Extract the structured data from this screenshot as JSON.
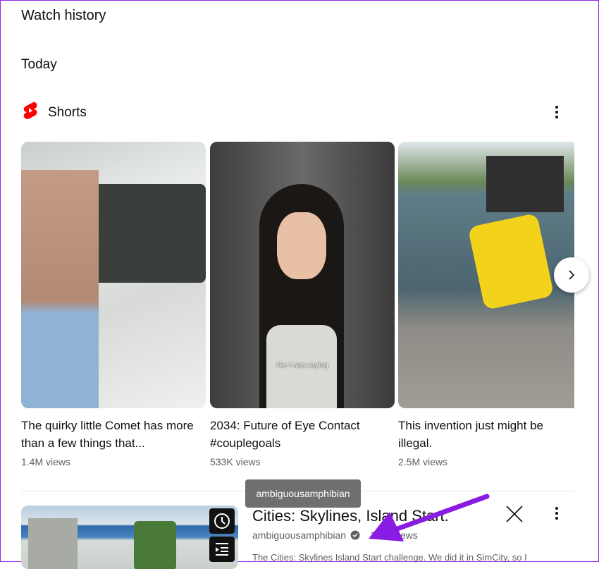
{
  "page_title": "Watch history",
  "section_date": "Today",
  "shorts": {
    "label": "Shorts",
    "icon": "youtube-shorts-icon",
    "brand_color": "#ff0000",
    "items": [
      {
        "title": "The quirky little Comet has more than a few things that...",
        "views": "1.4M views"
      },
      {
        "title": "2034: Future of Eye Contact #couplegoals",
        "views": "533K views",
        "caption": "like I was saying"
      },
      {
        "title": "This invention just might be illegal.",
        "views": "2.5M views"
      }
    ]
  },
  "video": {
    "title": "Cities: Skylines, Island Start.",
    "channel": "ambiguousamphibian",
    "views": "1.6K views",
    "description": "The Cities: Skylines Island Start challenge. We did it in SimCity, so I",
    "tooltip": "ambiguousamphibian"
  },
  "annotation_color": "#8a1be2"
}
